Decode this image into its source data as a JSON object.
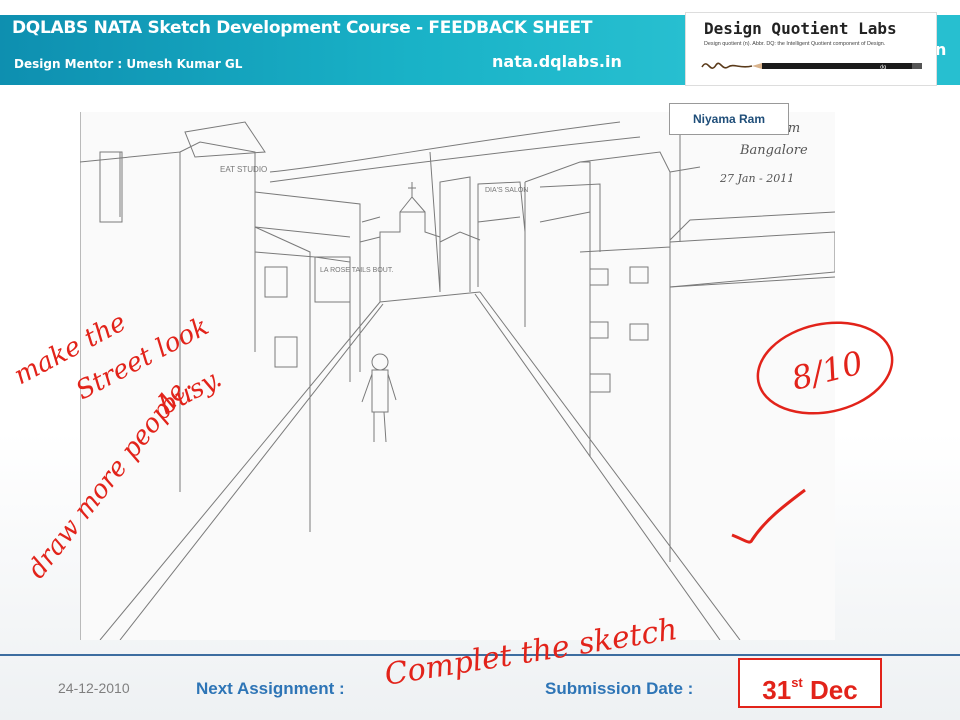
{
  "header": {
    "title": "DQLABS   NATA  Sketch Development Course  - FEEDBACK SHEET",
    "mentor": "Design Mentor :  Umesh Kumar GL",
    "site": "nata.dqlabs.in"
  },
  "logo": {
    "title": "Design Quotient Labs",
    "tagline": "Design quotient (n). Abbr. DQ: the Intelligent Quotient component of Design.",
    "pencil_mark": "dq",
    "strip_text": "n"
  },
  "student": {
    "name": "Niyama Ram"
  },
  "sketch": {
    "signature_lines": [
      "Ram",
      "Bangalore",
      "27  Jan - 2011"
    ],
    "shop_signs": [
      "DIA'S SALON",
      "EAT STUDIO",
      "LA ROSE TAILS BOUT."
    ]
  },
  "feedback": {
    "comment_lines": [
      "make the",
      "Street look",
      "busy.",
      "draw more people."
    ],
    "score": "8/10",
    "check_mark": "✓"
  },
  "footer": {
    "date": "24-12-2010",
    "next_label": "Next Assignment  :",
    "next_value": "Complet the sketch",
    "submission_label": "Submission Date  :",
    "submission_day": "31",
    "submission_suffix": "st",
    "submission_month": "Dec"
  },
  "colors": {
    "header_bg": "#19b2c7",
    "annotation_red": "#e2231a",
    "label_blue": "#2e75b6",
    "footer_line": "#3d6da0"
  }
}
